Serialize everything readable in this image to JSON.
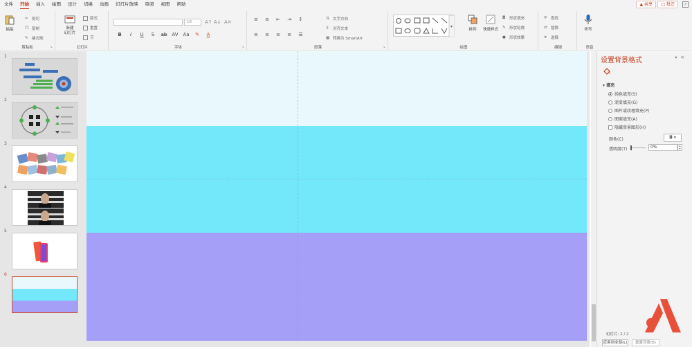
{
  "menu": {
    "tabs": [
      "文件",
      "开始",
      "插入",
      "绘图",
      "设计",
      "切换",
      "动画",
      "幻灯片放映",
      "审阅",
      "视图",
      "帮助"
    ],
    "active": "开始",
    "share": "共享",
    "comments": "批注"
  },
  "ribbon": {
    "clipboard": {
      "paste": "粘贴",
      "cut": "剪切",
      "copy": "复制",
      "format_painter": "格式刷",
      "label": "剪贴板"
    },
    "slides": {
      "new_slide": "新建\n幻灯片",
      "layout": "版式",
      "reset": "重置",
      "section": "节",
      "label": "幻灯片"
    },
    "font": {
      "font_name": "",
      "font_size": "18",
      "label": "字体"
    },
    "paragraph": {
      "text_direction": "文字方向",
      "align_text": "对齐文本",
      "smartart": "转换为 SmartArt",
      "label": "段落"
    },
    "drawing": {
      "arrange": "排列",
      "quick_styles": "快速样式",
      "shape_fill": "形状填充",
      "shape_outline": "形状轮廓",
      "shape_effects": "形状效果",
      "label": "绘图"
    },
    "editing": {
      "find": "查找",
      "replace": "替换",
      "select": "选择",
      "label": "编辑"
    },
    "voice": {
      "dictate": "听写",
      "label": "语音"
    }
  },
  "thumbnails": [
    {
      "num": "1"
    },
    {
      "num": "2"
    },
    {
      "num": "3"
    },
    {
      "num": "4"
    },
    {
      "num": "5"
    },
    {
      "num": "6",
      "active": true
    }
  ],
  "slide": {
    "bands": [
      {
        "color": "#e8f8fc"
      },
      {
        "color": "#73e8fb"
      },
      {
        "color": "#a59ff7"
      }
    ]
  },
  "format_pane": {
    "title": "设置背景格式",
    "section": "填充",
    "options": [
      {
        "label": "纯色填充(S)",
        "selected": true
      },
      {
        "label": "渐变填充(G)",
        "selected": false
      },
      {
        "label": "图片或纹理填充(P)",
        "selected": false
      },
      {
        "label": "图案填充(A)",
        "selected": false
      }
    ],
    "hide_bg_graphics": "隐藏背景图形(H)",
    "color_label": "颜色(C)",
    "transparency_label": "透明度(T)",
    "transparency_value": "0%",
    "apply_all": "应用到全部(L)",
    "reset_bg": "重置背景(B)"
  },
  "status": {
    "slide_counter": "幻灯片: 2 / 2"
  },
  "colors": {
    "accent": "#c43e1c",
    "active_border": "#d04a2a"
  }
}
